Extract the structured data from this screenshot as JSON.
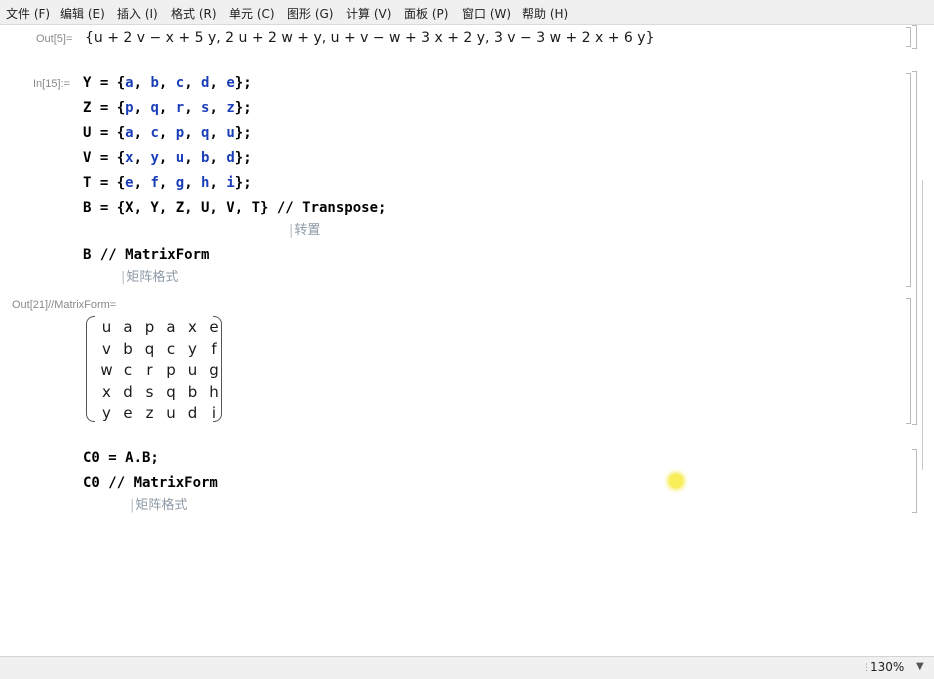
{
  "menu": [
    "文件 (F)",
    "编辑 (E)",
    "插入 (I)",
    "格式 (R)",
    "单元 (C)",
    "图形 (G)",
    "计算 (V)",
    "面板 (P)",
    "窗口 (W)",
    "帮助 (H)"
  ],
  "cells": {
    "out5_label": "Out[5]=",
    "out5_text": "{u + 2 v − x + 5 y, 2 u + 2 w + y, u + v − w + 3 x + 2 y, 3 v − 3 w + 2 x + 6 y}",
    "in15_label": "In[15]:=",
    "in15_lines": [
      {
        "name": "Y",
        "items": [
          "a",
          "b",
          "c",
          "d",
          "e"
        ]
      },
      {
        "name": "Z",
        "items": [
          "p",
          "q",
          "r",
          "s",
          "z"
        ]
      },
      {
        "name": "U",
        "items": [
          "a",
          "c",
          "p",
          "q",
          "u"
        ]
      },
      {
        "name": "V",
        "items": [
          "x",
          "y",
          "u",
          "b",
          "d"
        ]
      },
      {
        "name": "T",
        "items": [
          "e",
          "f",
          "g",
          "h",
          "i"
        ]
      }
    ],
    "b_def": "B = {X, Y, Z, U, V, T} // Transpose;",
    "transpose_tip": "转置",
    "b_matrixform": "B // MatrixForm",
    "matrixform_tip": "矩阵格式",
    "out21_label": "Out[21]//MatrixForm=",
    "matrix": [
      [
        "u",
        "a",
        "p",
        "a",
        "x",
        "e"
      ],
      [
        "v",
        "b",
        "q",
        "c",
        "y",
        "f"
      ],
      [
        "w",
        "c",
        "r",
        "p",
        "u",
        "g"
      ],
      [
        "x",
        "d",
        "s",
        "q",
        "b",
        "h"
      ],
      [
        "y",
        "e",
        "z",
        "u",
        "d",
        "i"
      ]
    ],
    "c0_def": "C0 = A.B;",
    "c0_matrixform": "C0 // MatrixForm",
    "matrixform_tip2": "矩阵格式"
  },
  "status": {
    "zoom": "130%"
  }
}
